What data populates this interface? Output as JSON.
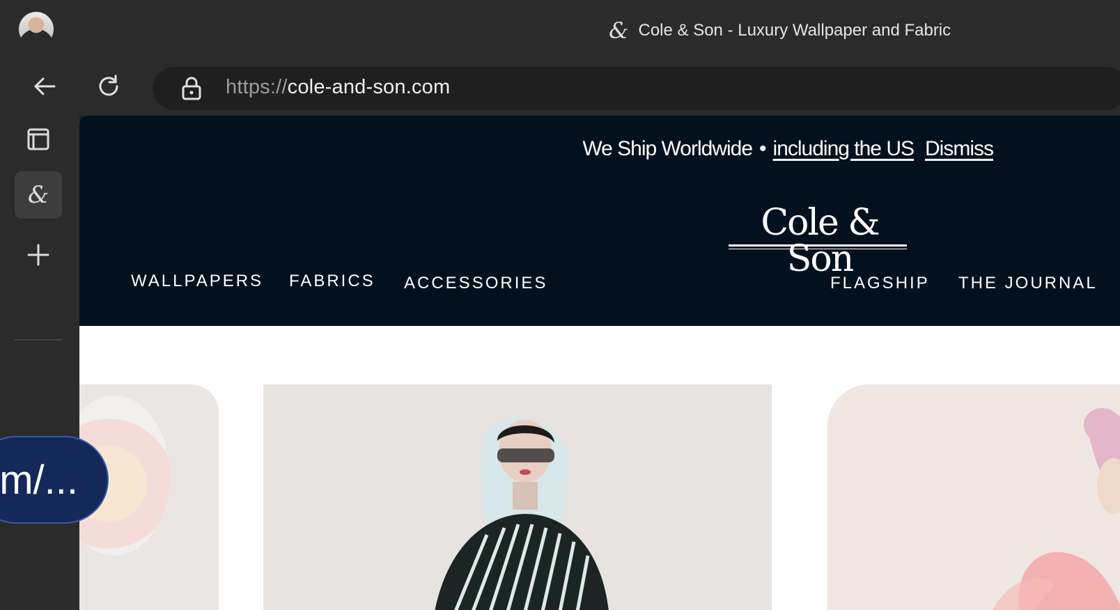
{
  "browser": {
    "tab_title": "Cole & Son - Luxury Wallpaper and Fabric",
    "tab_favicon": "&",
    "url_scheme": "https://",
    "url_host": "cole-and-son.com"
  },
  "icons": {
    "profile": "avatar",
    "back": "back-arrow-icon",
    "reload": "reload-icon",
    "lock": "lock-icon",
    "tabs": "tab-actions-icon",
    "new_tab": "plus-icon"
  },
  "sidebar": {
    "active_tab_glyph": "&"
  },
  "site": {
    "banner": {
      "text": "We Ship Worldwide",
      "bullet": "•",
      "link": "including the US",
      "dismiss": "Dismiss"
    },
    "logo": "Cole & Son",
    "nav_left": [
      "WALLPAPERS",
      "FABRICS",
      "ACCESSORIES"
    ],
    "nav_right": [
      "FLAGSHIP",
      "THE JOURNAL"
    ]
  },
  "overlay": {
    "url_pill": "m/..."
  },
  "colors": {
    "header_bg": "#03111f",
    "chrome_bg": "#2b2b2b",
    "pill_bg": "#14295a"
  }
}
